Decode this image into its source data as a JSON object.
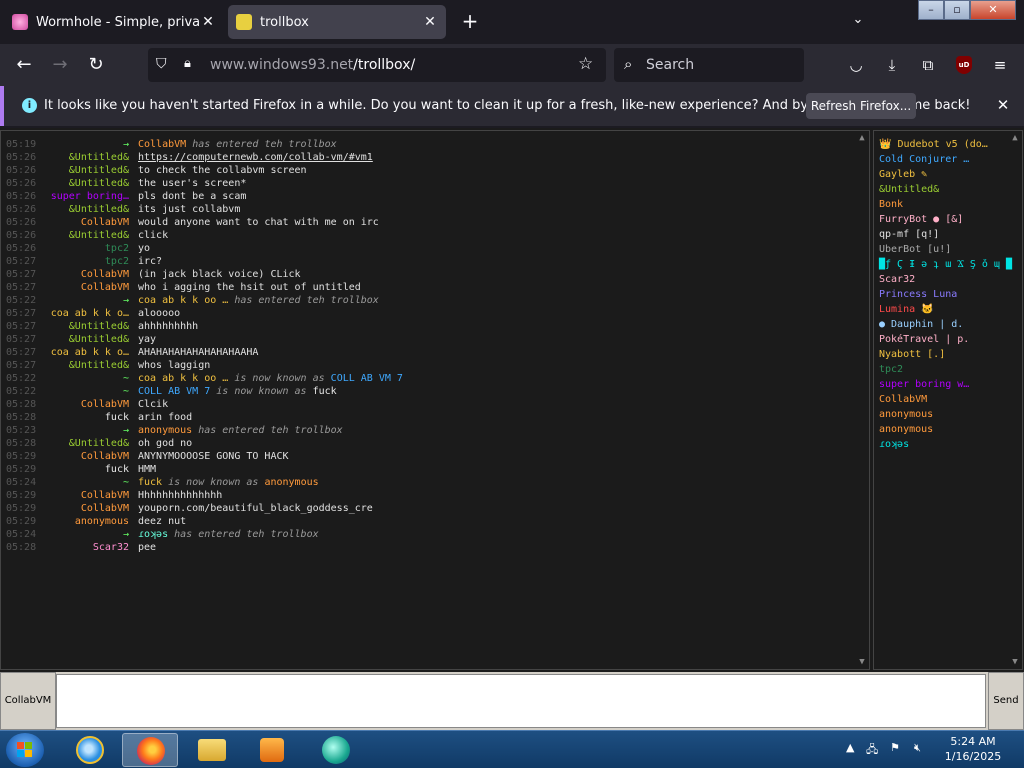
{
  "browser": {
    "tabs": [
      {
        "title": "Wormhole - Simple, private file",
        "active": false
      },
      {
        "title": "trollbox",
        "active": true
      }
    ],
    "url_host": "www.windows93.net",
    "url_path": "/trollbox/",
    "search_placeholder": "Search",
    "ublock_label": "uD"
  },
  "notification": {
    "message": "It looks like you haven't started Firefox in a while. Do you want to clean it up for a fresh, like-new experience? And by the way, welcome back!",
    "button_label": "Refresh Firefox..."
  },
  "chat": {
    "messages": [
      {
        "time": "05:19",
        "nick": "→",
        "nick_color": "arrow",
        "text": "",
        "event_nick": "CollabVM",
        "event_text": " has entered teh trollbox"
      },
      {
        "time": "05:26",
        "nick": "&Untitled&",
        "nick_color": "green",
        "text": "https://computernewb.com/collab-vm/#vm1",
        "link": true
      },
      {
        "time": "05:26",
        "nick": "&Untitled&",
        "nick_color": "green",
        "text": "to check the collabvm screen"
      },
      {
        "time": "05:26",
        "nick": "&Untitled&",
        "nick_color": "green",
        "text": "the user's screen*"
      },
      {
        "time": "05:26",
        "nick": "super boring…",
        "nick_color": "purple",
        "text": "pls dont be a scam"
      },
      {
        "time": "05:26",
        "nick": "&Untitled&",
        "nick_color": "green",
        "text": "its just collabvm"
      },
      {
        "time": "05:26",
        "nick": "CollabVM",
        "nick_color": "orange",
        "text": "would anyone want to chat with me on irc"
      },
      {
        "time": "05:26",
        "nick": "&Untitled&",
        "nick_color": "green",
        "text": "click"
      },
      {
        "time": "05:26",
        "nick": "tpc2",
        "nick_color": "dkgreen",
        "text": "yo"
      },
      {
        "time": "05:27",
        "nick": "tpc2",
        "nick_color": "dkgreen",
        "text": "irc?"
      },
      {
        "time": "05:27",
        "nick": "CollabVM",
        "nick_color": "orange",
        "text": "(in jack black voice) CLick"
      },
      {
        "time": "05:27",
        "nick": "CollabVM",
        "nick_color": "orange",
        "text": "who i agging the hsit out of untitled"
      },
      {
        "time": "05:22",
        "nick": "→",
        "nick_color": "arrow",
        "text": "",
        "event_nick": "coa ab k k oo …",
        "event_nick_color": "yellow",
        "event_text": " has entered teh trollbox"
      },
      {
        "time": "05:27",
        "nick": "coa ab k k o…",
        "nick_color": "yellow",
        "text": "alooooo"
      },
      {
        "time": "05:27",
        "nick": "&Untitled&",
        "nick_color": "green",
        "text": "ahhhhhhhhh"
      },
      {
        "time": "05:27",
        "nick": "&Untitled&",
        "nick_color": "green",
        "text": "yay"
      },
      {
        "time": "05:27",
        "nick": "coa ab k k o…",
        "nick_color": "yellow",
        "text": "AHAHAHAHAHAHAHAHAAHA"
      },
      {
        "time": "05:27",
        "nick": "&Untitled&",
        "nick_color": "green",
        "text": "whos laggign"
      },
      {
        "time": "05:22",
        "nick": "~",
        "nick_color": "arrow",
        "text": "",
        "event_nick": "coa ab k k oo …",
        "event_nick_color": "yellow",
        "event_text": " is now known as ",
        "event_target": "COLL AB VM 7",
        "event_target_color": "blue"
      },
      {
        "time": "05:22",
        "nick": "~",
        "nick_color": "arrow",
        "text": "",
        "event_nick": "COLL AB VM 7",
        "event_nick_color": "blue",
        "event_text": " is now known as ",
        "event_target": "fuck",
        "event_target_color": "white"
      },
      {
        "time": "05:28",
        "nick": "CollabVM",
        "nick_color": "orange",
        "text": "Clcik"
      },
      {
        "time": "05:28",
        "nick": "fuck",
        "nick_color": "white",
        "text": "arin food"
      },
      {
        "time": "05:23",
        "nick": "→",
        "nick_color": "arrow",
        "text": "",
        "event_nick": "anonymous",
        "event_nick_color": "orange",
        "event_text": " has entered teh trollbox"
      },
      {
        "time": "05:28",
        "nick": "&Untitled&",
        "nick_color": "green",
        "text": "oh god no"
      },
      {
        "time": "05:29",
        "nick": "CollabVM",
        "nick_color": "orange",
        "text": "ANYNYMOOOOSE GONG TO HACK"
      },
      {
        "time": "05:29",
        "nick": "fuck",
        "nick_color": "white",
        "text": "HMM"
      },
      {
        "time": "05:24",
        "nick": "~",
        "nick_color": "arrow",
        "text": "",
        "event_nick": "fuck",
        "event_nick_color": "yellow",
        "event_text": " is now known as ",
        "event_target": "anonymous",
        "event_target_color": "orange"
      },
      {
        "time": "05:29",
        "nick": "CollabVM",
        "nick_color": "orange",
        "text": "Hhhhhhhhhhhhhh"
      },
      {
        "time": "05:29",
        "nick": "CollabVM",
        "nick_color": "orange",
        "text": "youporn.com/beautiful_black_goddess_cre"
      },
      {
        "time": "05:29",
        "nick": "anonymous",
        "nick_color": "orange",
        "text": "deez nut"
      },
      {
        "time": "05:24",
        "nick": "→",
        "nick_color": "arrow",
        "text": "",
        "event_nick": "ɾoʞǝs",
        "event_nick_color": "teal",
        "event_text": " has entered teh trollbox"
      },
      {
        "time": "05:28",
        "nick": "Scar32",
        "nick_color": "pink",
        "text": "pee"
      }
    ]
  },
  "users": [
    {
      "name": "👑 Dudebot v5 (do…",
      "color": "yellow"
    },
    {
      "name": "Cold Conjurer …",
      "color": "blue"
    },
    {
      "name": "Gayleb ✎",
      "color": "yellow"
    },
    {
      "name": "&Untitled&",
      "color": "green"
    },
    {
      "name": "Bonk",
      "color": "orange"
    },
    {
      "name": "FurryBot ● [&]",
      "color": "pink"
    },
    {
      "name": "qp-mf [q!]",
      "color": "white"
    },
    {
      "name": "UberBot [u!]",
      "color": "gray"
    },
    {
      "name": "█ƒ Ϛ Ɨ ǝ ʇ ɯ Ϫ Ş ǒ ɰ █",
      "color": "teal"
    },
    {
      "name": "Scar32",
      "color": "pink"
    },
    {
      "name": "Princess Luna",
      "color": "purple-blue"
    },
    {
      "name": "Lumina 🐱",
      "color": "red"
    },
    {
      "name": "● Dauphin | d.",
      "color": "lightblue"
    },
    {
      "name": "PokéTravel | p.",
      "color": "pink"
    },
    {
      "name": "Nyabott [.]",
      "color": "yellow"
    },
    {
      "name": "tpc2",
      "color": "dkgreen"
    },
    {
      "name": "super boring w…",
      "color": "purple"
    },
    {
      "name": "CollabVM",
      "color": "orange"
    },
    {
      "name": "anonymous",
      "color": "orange"
    },
    {
      "name": "anonymous",
      "color": "orange"
    },
    {
      "name": "ɾoʞǝs",
      "color": "teal"
    }
  ],
  "input": {
    "nick_button": "CollabVM",
    "send_button": "Send"
  },
  "taskbar": {
    "time": "5:24 AM",
    "date": "1/16/2025"
  }
}
